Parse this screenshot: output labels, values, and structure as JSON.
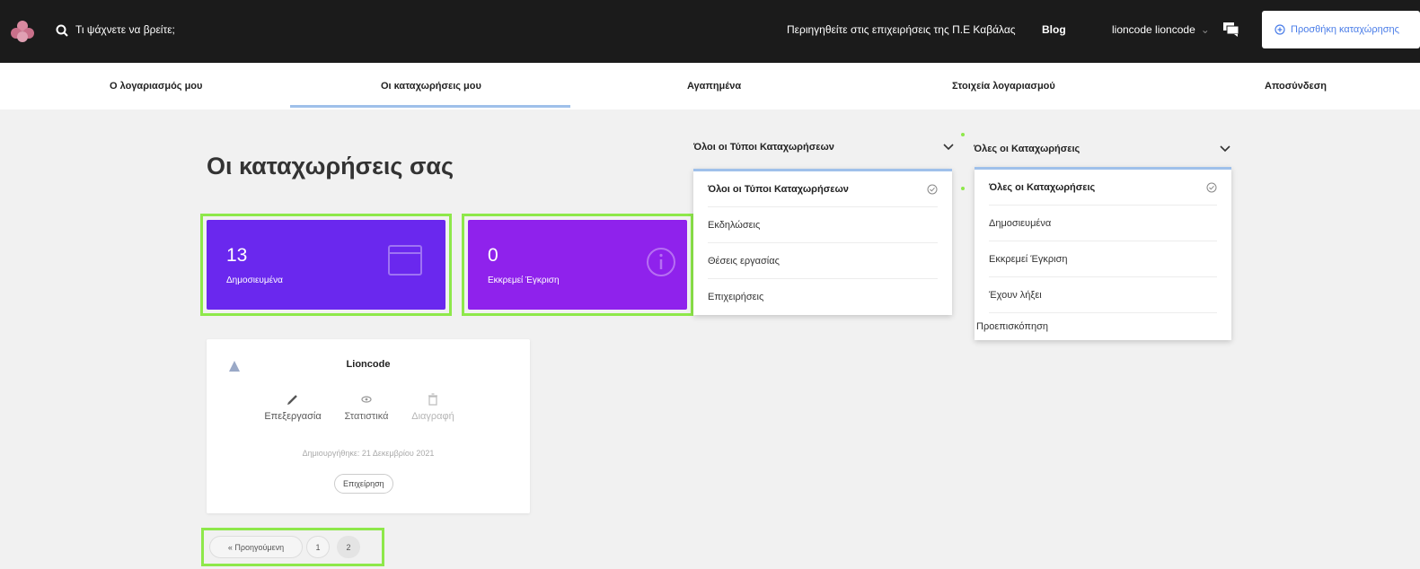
{
  "topbar": {
    "search_label": "Τι ψάχνετε να βρείτε;",
    "browse_link": "Περιηγηθείτε στις επιχειρήσεις της Π.Ε Καβάλας",
    "blog_link": "Blog",
    "user_name": "lioncode lioncode",
    "add_listing_label": "Προσθήκη καταχώρησης"
  },
  "nav": {
    "tabs": [
      {
        "label": "Ο λογαριασμός μου"
      },
      {
        "label": "Οι καταχωρήσεις μου"
      },
      {
        "label": "Αγαπημένα"
      },
      {
        "label": "Στοιχεία λογαριασμού"
      },
      {
        "label": "Αποσύνδεση"
      }
    ],
    "active_tab": "Οι καταχωρήσεις μου"
  },
  "page": {
    "title": "Οι καταχωρήσεις σας"
  },
  "stats": [
    {
      "value": "13",
      "label": "Δημοσιευμένα",
      "color": "#6a28ee"
    },
    {
      "value": "0",
      "label": "Εκκρεμεί Έγκριση",
      "color": "#8f22ec"
    }
  ],
  "type_filter": {
    "selected": "Όλοι οι Τύποι Καταχωρήσεων",
    "options": [
      "Όλοι οι Τύποι Καταχωρήσεων",
      "Εκδηλώσεις",
      "Θέσεις εργασίας",
      "Επιχειρήσεις"
    ]
  },
  "status_filter": {
    "selected": "Όλες οι Καταχωρήσεις",
    "options": [
      "Όλες οι Καταχωρήσεις",
      "Δημοσιευμένα",
      "Εκκρεμεί Έγκριση",
      "Έχουν λήξει",
      "Προεπισκόπηση"
    ]
  },
  "listing": {
    "name": "Lioncode",
    "actions": {
      "edit": "Επεξεργασία",
      "stats": "Στατιστικά",
      "delete": "Διαγραφή"
    },
    "created": "Δημιουργήθηκε: 21 Δεκεμβρίου 2021",
    "type": "Επιχείρηση"
  },
  "pagination": {
    "prev": "« Προηγούμενη",
    "pages": [
      "1",
      "2"
    ],
    "current": "2"
  },
  "colors": {
    "accent": "#4a7de8",
    "highlight": "#8ee84a",
    "topbar": "#1b1b1b"
  }
}
